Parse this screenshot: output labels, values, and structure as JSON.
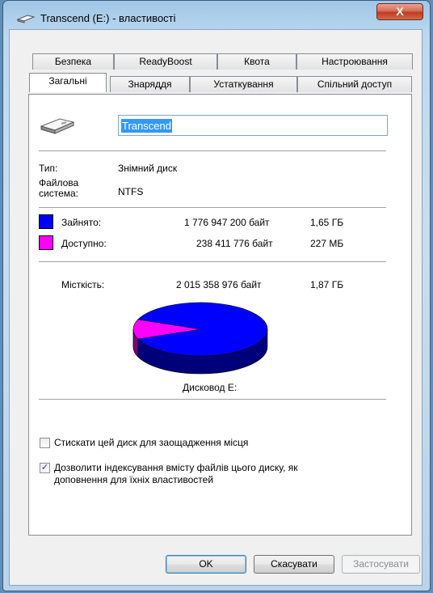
{
  "window": {
    "title": "Transcend (E:) - властивості",
    "close_symbol": "X"
  },
  "tabs_back": [
    "Безпека",
    "ReadyBoost",
    "Квота",
    "Настроювання"
  ],
  "tabs_front": [
    "Загальні",
    "Знаряддя",
    "Устаткування",
    "Спільний доступ"
  ],
  "general": {
    "drive_name": "Transcend",
    "type_label": "Тип:",
    "type_value": "Знімний диск",
    "fs_label_1": "Файлова",
    "fs_label_2": "система:",
    "fs_value": "NTFS",
    "used_label": "Зайнято:",
    "used_bytes": "1 776 947 200 байт",
    "used_size": "1,65 ГБ",
    "free_label": "Доступно:",
    "free_bytes": "238 411 776 байт",
    "free_size": "227 МБ",
    "capacity_label": "Місткість:",
    "capacity_bytes": "2 015 358 976 байт",
    "capacity_size": "1,87 ГБ",
    "drive_caption": "Дисковод E:",
    "used_fraction": 0.8817,
    "colors": {
      "used": "#0000ff",
      "free": "#ff00ff"
    }
  },
  "options": {
    "compress_label": "Стискати цей диск для заощадження місця",
    "compress_checked": false,
    "index_label_1": "Дозволити індексування вмісту файлів цього диску, як",
    "index_label_2": "доповнення для їхніх властивостей",
    "index_checked": true
  },
  "buttons": {
    "ok": "OK",
    "cancel": "Скасувати",
    "apply": "Застосувати"
  },
  "icons": {
    "title": "removable-drive-icon",
    "drive": "usb-drive-icon"
  }
}
